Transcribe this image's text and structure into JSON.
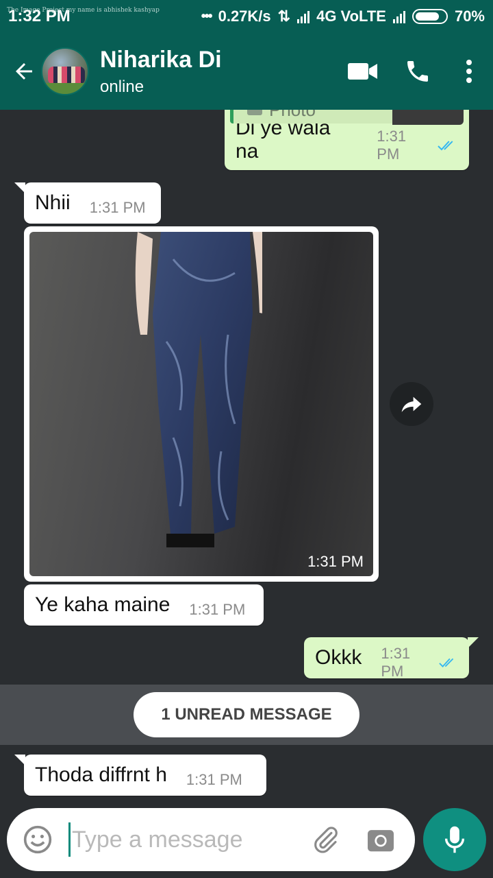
{
  "status_bar": {
    "time": "1:32 PM",
    "watermark": "The Image Project my name is abhishek kashyap",
    "net_speed": "0.27K/s",
    "network": "4G VoLTE",
    "battery": "70%"
  },
  "header": {
    "contact_name": "Niharika Di",
    "contact_status": "online",
    "icons": [
      "back-arrow-icon",
      "video-call-icon",
      "phone-icon",
      "more-vert-icon"
    ]
  },
  "messages": [
    {
      "direction": "out",
      "quote_label": "Photo",
      "text": "Di ye wala na",
      "time": "1:31 PM",
      "ticks": "read"
    },
    {
      "direction": "in",
      "text": "Nhii",
      "time": "1:31 PM"
    },
    {
      "direction": "in",
      "type": "image",
      "time": "1:31 PM"
    },
    {
      "direction": "in",
      "text": "Ye kaha maine",
      "time": "1:31 PM"
    },
    {
      "direction": "out",
      "text": "Okkk",
      "time": "1:31 PM",
      "ticks": "read"
    },
    {
      "direction": "in",
      "text": "Thoda diffrnt h",
      "time": "1:31 PM"
    }
  ],
  "unread_banner": "1 UNREAD MESSAGE",
  "composer": {
    "placeholder": "Type a message",
    "icons": [
      "emoji-icon",
      "attach-icon",
      "camera-icon",
      "mic-icon"
    ]
  },
  "colors": {
    "header_bg": "#075e54",
    "chat_bg": "#2a2d30",
    "outgoing_bubble": "#dcf8c6",
    "incoming_bubble": "#ffffff",
    "read_tick": "#34b7f1",
    "mic_button": "#0f8f80"
  }
}
